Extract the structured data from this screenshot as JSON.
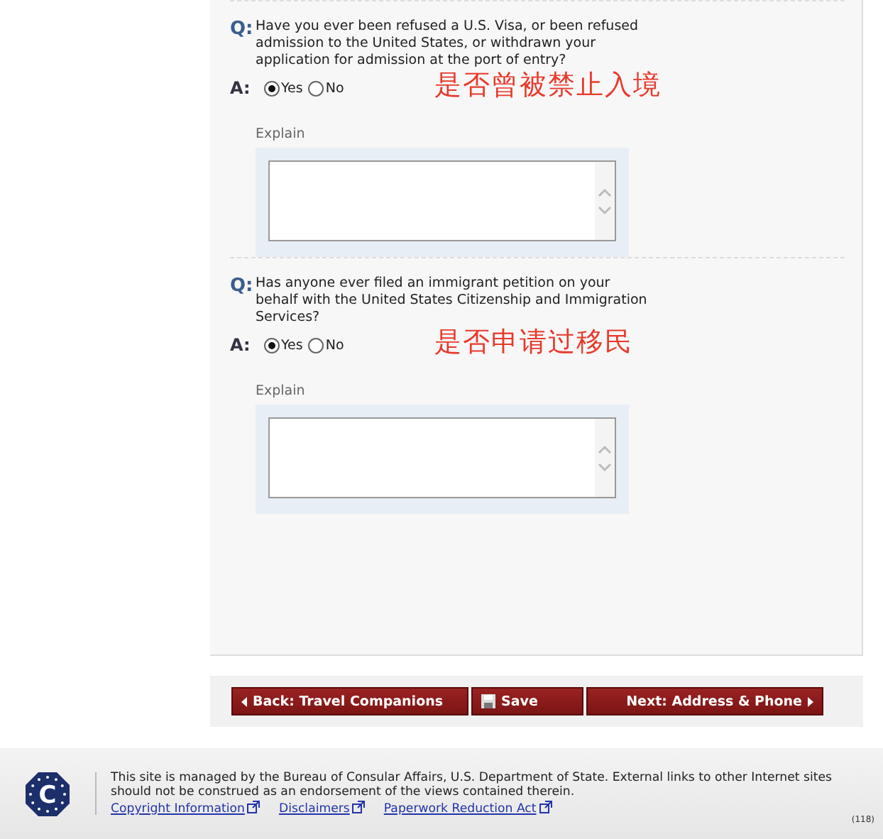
{
  "questions": [
    {
      "q_mark": "Q:",
      "text": "Have you ever been refused a U.S. Visa, or been refused admission to the United States, or withdrawn your application for admission at the port of entry?",
      "a_mark": "A:",
      "options": [
        {
          "label": "Yes",
          "selected": true
        },
        {
          "label": "No",
          "selected": false
        }
      ],
      "annotation": "是否曾被禁止入境",
      "explain_label": "Explain"
    },
    {
      "q_mark": "Q:",
      "text": "Has anyone ever filed an immigrant petition on your behalf with the United States Citizenship and Immigration Services?",
      "a_mark": "A:",
      "options": [
        {
          "label": "Yes",
          "selected": true
        },
        {
          "label": "No",
          "selected": false
        }
      ],
      "annotation": "是否申请过移民",
      "explain_label": "Explain"
    }
  ],
  "nav_buttons": [
    {
      "kind": "back",
      "label": "Back: Travel Companions"
    },
    {
      "kind": "save",
      "label": "Save"
    },
    {
      "kind": "next",
      "label": "Next: Address & Phone"
    }
  ],
  "footer": {
    "logo_letter": "C",
    "text": "This site is managed by the Bureau of Consular Affairs, U.S. Department of State. External links to other Internet sites should not be construed as an endorsement of the views contained therein.",
    "links": [
      "Copyright Information",
      "Disclaimers",
      "Paperwork Reduction Act"
    ],
    "page_code": "(118)"
  }
}
